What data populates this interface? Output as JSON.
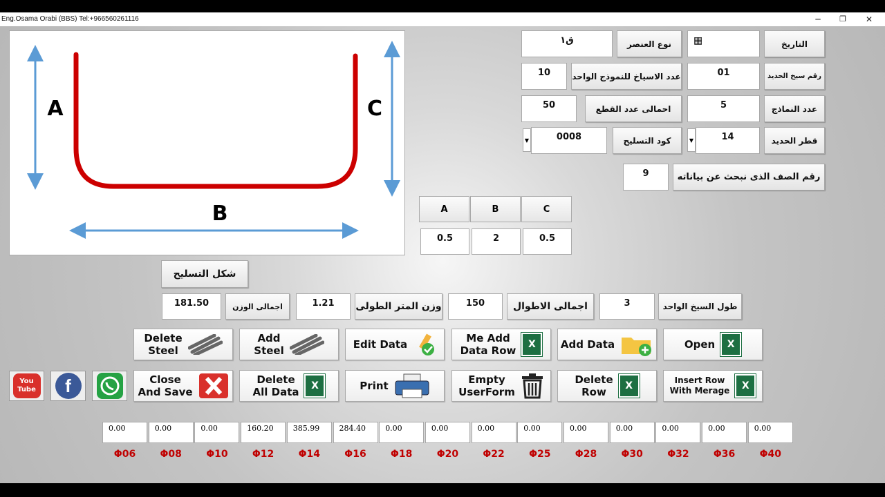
{
  "window": {
    "title": "Eng.Osama Orabi (BBS) Tel:+966560261116",
    "minimize": "─",
    "restore": "❐",
    "close": "✕"
  },
  "shape": {
    "labels": {
      "a": "A",
      "b": "B",
      "c": "C"
    },
    "bar_color": "#cc0000",
    "arrow_color": "#5b9bd5"
  },
  "form": {
    "date_label": "التاريخ",
    "date_value": "",
    "element_type_label": "نوع العنصر",
    "element_type_value": "ق١",
    "mesh_no_label": "رقم سيخ الحديد",
    "mesh_no_value": "01",
    "bars_per_model_label": "عدد الاسياخ للنموذج الواحد",
    "bars_per_model_value": "10",
    "models_count_label": "عدد النماذج",
    "models_count_value": "5",
    "total_pieces_label": "احمالى عدد القطع",
    "total_pieces_value": "50",
    "diameter_label": "قطر الحديد",
    "diameter_value": "14",
    "rebar_code_label": "كود التسليح",
    "rebar_code_value": "0008",
    "search_row_label": "رقم الصف الذى نبحث عن بياناته",
    "search_row_value": "9"
  },
  "dims": {
    "headers": [
      "A",
      "B",
      "C"
    ],
    "values": [
      "0.5",
      "2",
      "0.5"
    ]
  },
  "shape_button": "شكل التسليح",
  "totals": {
    "total_weight_label": "اجمالى الوزن",
    "total_weight_value": "181.50",
    "unit_weight_label": "وزن المتر الطولى",
    "unit_weight_value": "1.21",
    "total_length_label": "اجمالى الاطوال",
    "total_length_value": "150",
    "bar_length_label": "طول السيخ الواحد",
    "bar_length_value": "3"
  },
  "buttons": {
    "delete_steel": "Delete\nSteel",
    "add_steel": "Add\nSteel",
    "edit_data": "Edit Data",
    "me_add_data_row": "Me Add\nData Row",
    "add_data": "Add Data",
    "open": "Open",
    "close_and_save": "Close\nAnd Save",
    "delete_all_data": "Delete\nAll Data",
    "print": "Print",
    "empty_userform": "Empty\nUserForm",
    "delete_row": "Delete\nRow",
    "insert_row_with_merage": "Insert Row\nWith Merage",
    "excel_glyph": "X",
    "youtube": "You\nTube",
    "facebook": "f"
  },
  "diameters": [
    {
      "label": "Φ06",
      "value": "0.00"
    },
    {
      "label": "Φ08",
      "value": "0.00"
    },
    {
      "label": "Φ10",
      "value": "0.00"
    },
    {
      "label": "Φ12",
      "value": "160.20"
    },
    {
      "label": "Φ14",
      "value": "385.99"
    },
    {
      "label": "Φ16",
      "value": "284.40"
    },
    {
      "label": "Φ18",
      "value": "0.00"
    },
    {
      "label": "Φ20",
      "value": "0.00"
    },
    {
      "label": "Φ22",
      "value": "0.00"
    },
    {
      "label": "Φ25",
      "value": "0.00"
    },
    {
      "label": "Φ28",
      "value": "0.00"
    },
    {
      "label": "Φ30",
      "value": "0.00"
    },
    {
      "label": "Φ32",
      "value": "0.00"
    },
    {
      "label": "Φ36",
      "value": "0.00"
    },
    {
      "label": "Φ40",
      "value": "0.00"
    }
  ]
}
